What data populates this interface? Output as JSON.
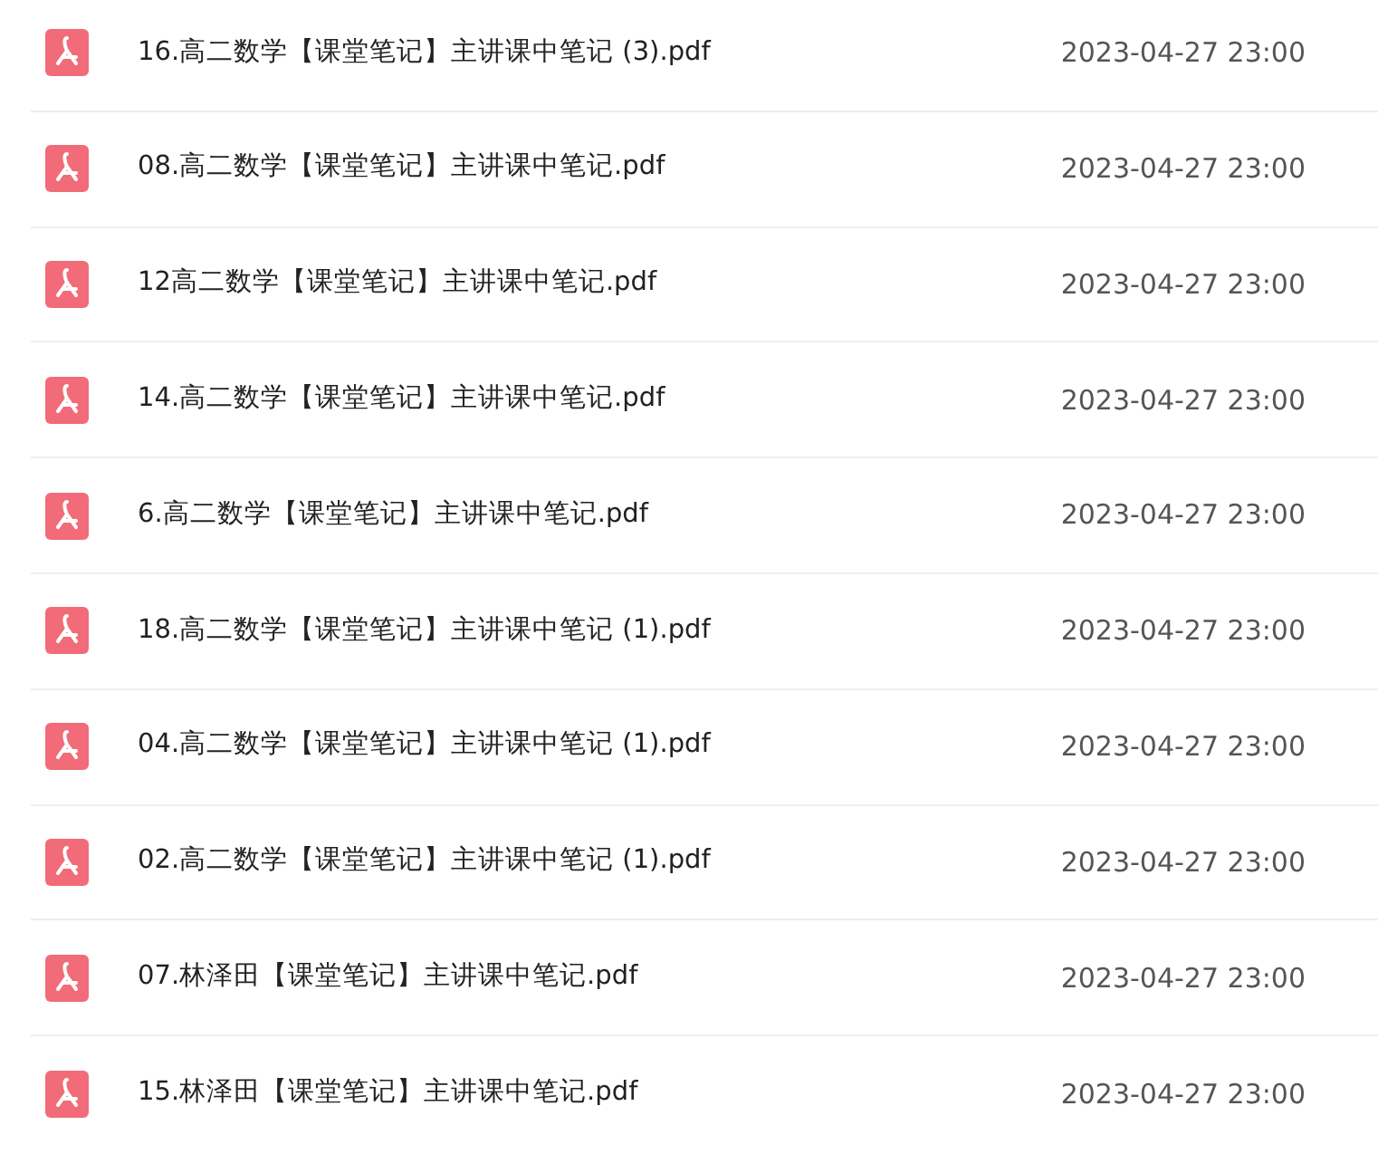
{
  "files": [
    {
      "name": "16.高二数学【课堂笔记】主讲课中笔记 (3).pdf",
      "date": "2023-04-27 23:00"
    },
    {
      "name": "08.高二数学【课堂笔记】主讲课中笔记.pdf",
      "date": "2023-04-27 23:00"
    },
    {
      "name": "12高二数学【课堂笔记】主讲课中笔记.pdf",
      "date": "2023-04-27 23:00"
    },
    {
      "name": "14.高二数学【课堂笔记】主讲课中笔记.pdf",
      "date": "2023-04-27 23:00"
    },
    {
      "name": "6.高二数学【课堂笔记】主讲课中笔记.pdf",
      "date": "2023-04-27 23:00"
    },
    {
      "name": "18.高二数学【课堂笔记】主讲课中笔记 (1).pdf",
      "date": "2023-04-27 23:00"
    },
    {
      "name": "04.高二数学【课堂笔记】主讲课中笔记 (1).pdf",
      "date": "2023-04-27 23:00"
    },
    {
      "name": "02.高二数学【课堂笔记】主讲课中笔记 (1).pdf",
      "date": "2023-04-27 23:00"
    },
    {
      "name": "07.林泽田【课堂笔记】主讲课中笔记.pdf",
      "date": "2023-04-27 23:00"
    },
    {
      "name": "15.林泽田【课堂笔记】主讲课中笔记.pdf",
      "date": "2023-04-27 23:00"
    }
  ]
}
